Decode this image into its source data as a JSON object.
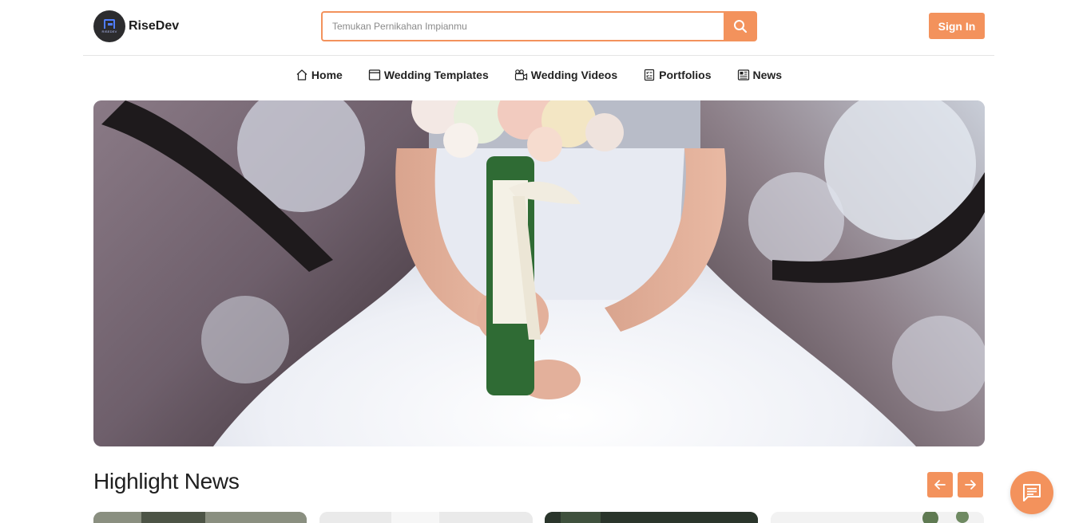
{
  "brand": {
    "name": "RiseDev",
    "logo_small_text": "RISEDEV"
  },
  "search": {
    "placeholder": "Temukan Pernikahan Impianmu",
    "icon": "search-icon"
  },
  "header": {
    "signin_label": "Sign In"
  },
  "nav": {
    "items": [
      {
        "label": "Home",
        "icon": "home-icon"
      },
      {
        "label": "Wedding Templates",
        "icon": "browser-window-icon"
      },
      {
        "label": "Wedding Videos",
        "icon": "video-camera-icon"
      },
      {
        "label": "Portfolios",
        "icon": "checklist-icon"
      },
      {
        "label": "News",
        "icon": "newspaper-icon"
      }
    ]
  },
  "hero": {
    "image": "bride-holding-bouquet-photo"
  },
  "highlight": {
    "title": "Highlight News",
    "prev_icon": "arrow-left-icon",
    "next_icon": "arrow-right-icon"
  },
  "chat": {
    "icon": "chat-icon"
  },
  "colors": {
    "accent": "#f3925c",
    "text": "#1f1f1f",
    "divider": "#e4e4e4"
  }
}
